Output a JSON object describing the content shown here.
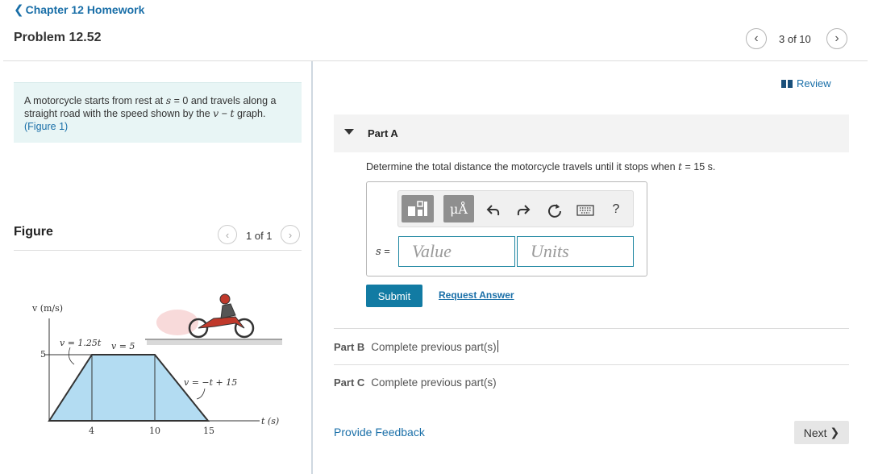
{
  "header": {
    "back_label": "Chapter 12 Homework",
    "problem_title": "Problem 12.52",
    "counter": "3 of 10"
  },
  "problem": {
    "text_before_s": "A motorcycle starts from rest at ",
    "var_s": "s",
    "text_mid": " = 0 and travels along a straight road with the speed shown by the ",
    "var_v": "v",
    "dash": " − ",
    "var_t": "t",
    "text_after": " graph.",
    "figure_link": "(Figure 1)"
  },
  "figure": {
    "label": "Figure",
    "counter": "1 of 1",
    "graph": {
      "ylabel": "v (m/s)",
      "xlabel": "t (s)",
      "y_tick": "5",
      "x_ticks": [
        "4",
        "10",
        "15"
      ],
      "eq1": "v = 1.25t",
      "eq2": "v = 5",
      "eq3": "v = −t + 15"
    }
  },
  "review": {
    "label": "Review"
  },
  "part_a": {
    "title": "Part A",
    "question_before": "Determine the total distance the motorcycle travels until it stops when ",
    "question_var": "t",
    "question_after": " = 15 s.",
    "input_label_var": "s",
    "input_label_eq": " =",
    "value_placeholder": "Value",
    "units_placeholder": "Units",
    "units_button": "μÅ",
    "help_button": "?",
    "submit_label": "Submit",
    "request_answer_label": "Request Answer"
  },
  "part_b": {
    "label": "Part B",
    "status": "Complete previous part(s)"
  },
  "part_c": {
    "label": "Part C",
    "status": "Complete previous part(s)"
  },
  "footer": {
    "feedback_label": "Provide Feedback",
    "next_label": "Next"
  },
  "colors": {
    "accent": "#1a6fa8",
    "submit": "#127ba3",
    "problem_bg": "#e8f5f5",
    "graph_fill": "#b3dcf2"
  },
  "icons": [
    "chevron-left-icon",
    "chevron-right-icon",
    "book-icon",
    "caret-down-icon",
    "template-icon",
    "undo-icon",
    "redo-icon",
    "reset-icon",
    "keyboard-icon",
    "motorcycle-icon"
  ]
}
